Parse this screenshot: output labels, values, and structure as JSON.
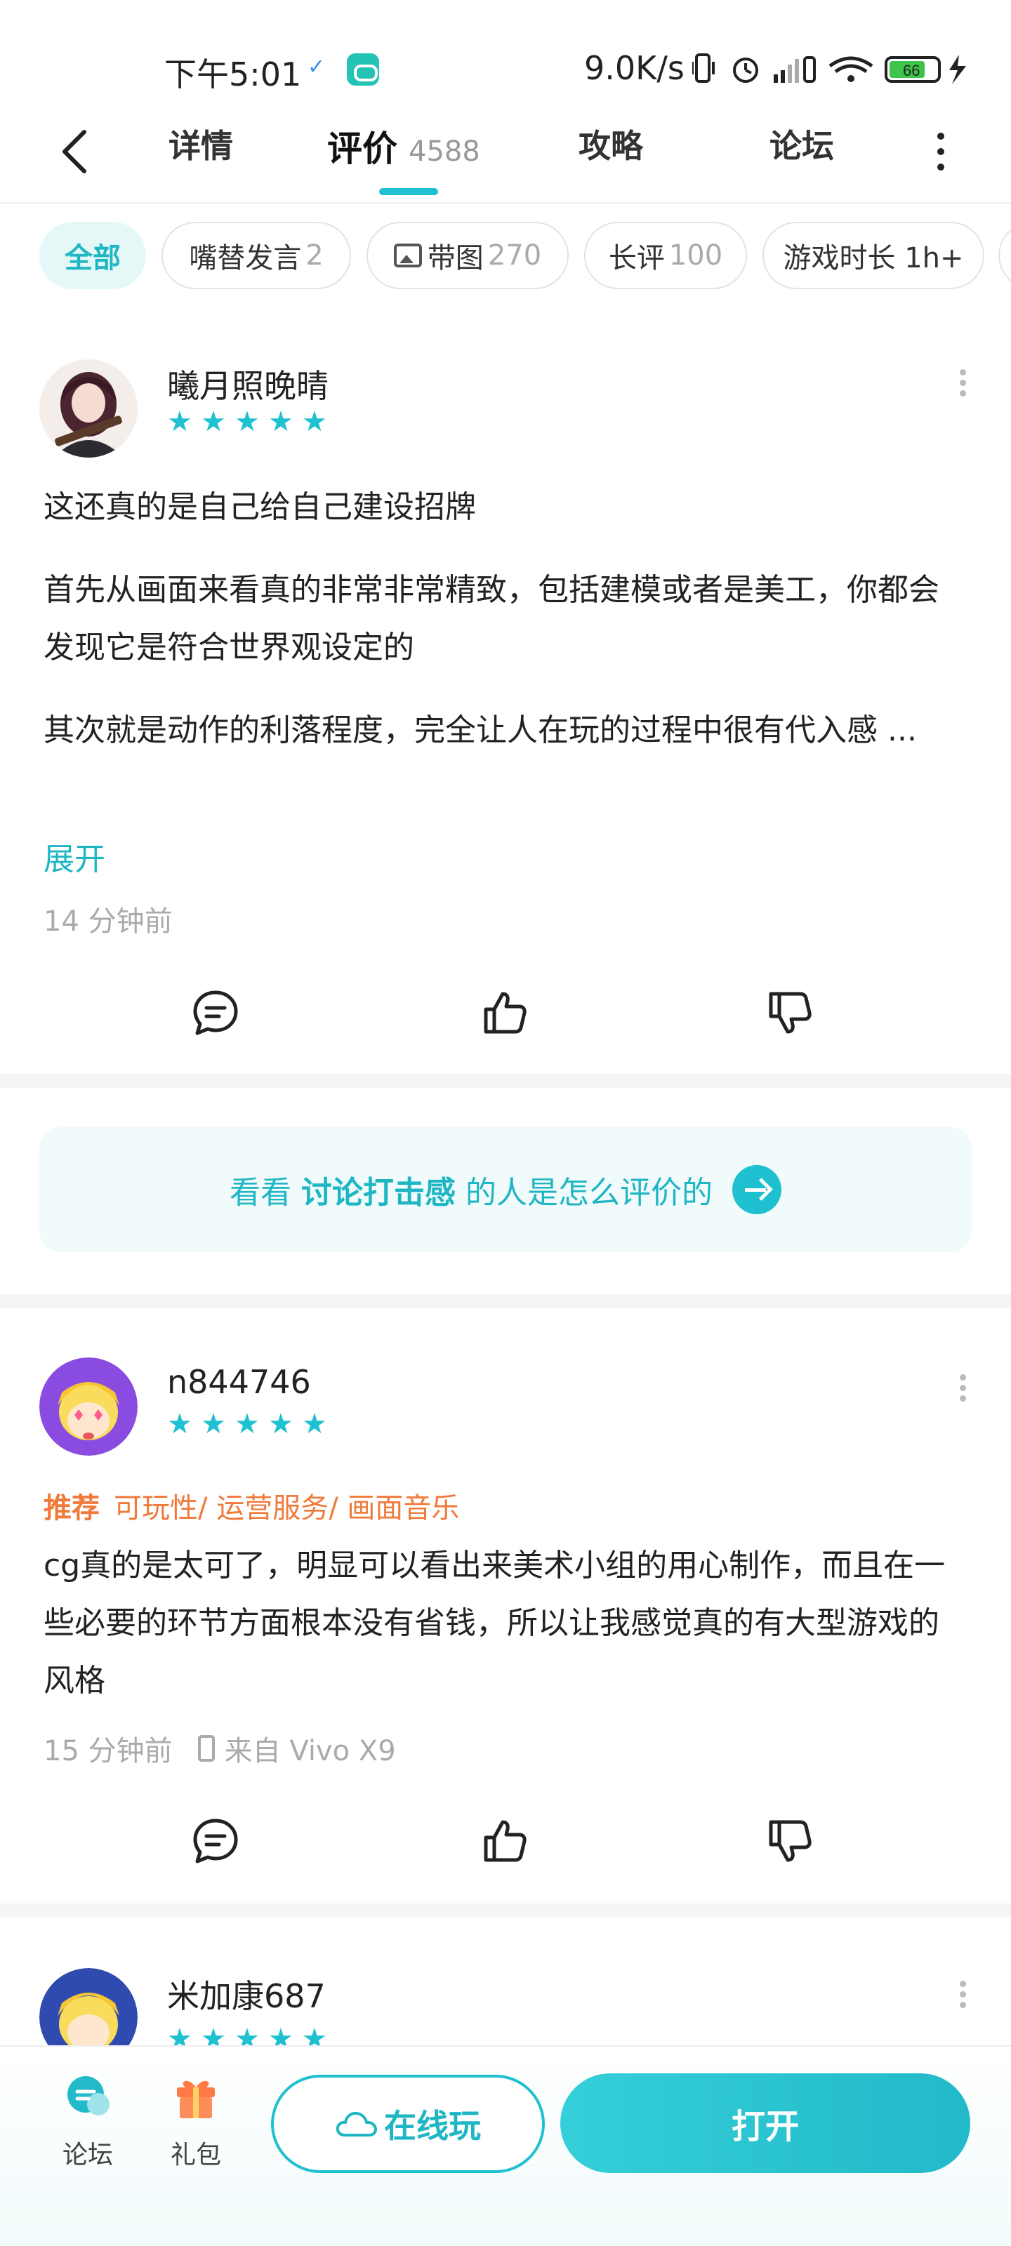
{
  "status_bar": {
    "time": "下午5:01",
    "network_speed": "9.0K/s",
    "battery": "66"
  },
  "nav": {
    "tabs": [
      {
        "label": "详情"
      },
      {
        "label": "评价",
        "count": "4588"
      },
      {
        "label": "攻略"
      },
      {
        "label": "论坛"
      }
    ]
  },
  "filters": [
    {
      "label": "全部",
      "count": ""
    },
    {
      "label": "嘴替发言",
      "count": "2"
    },
    {
      "label": "带图",
      "count": "270"
    },
    {
      "label": "长评",
      "count": "100"
    },
    {
      "label": "游戏时长 1h+",
      "count": ""
    }
  ],
  "reviews": [
    {
      "user": "曦月照晚晴",
      "rating": 5,
      "paragraphs": [
        "这还真的是自己给自己建设招牌",
        "首先从画面来看真的非常非常精致，包括建模或者是美工，你都会发现它是符合世界观设定的",
        "其次就是动作的利落程度，完全让人在玩的过程中很有代入感 ..."
      ],
      "expand_label": "展开",
      "time": "14 分钟前"
    },
    {
      "user": "n844746",
      "rating": 5,
      "tag_label": "推荐",
      "tags": "可玩性/ 运营服务/ 画面音乐",
      "paragraphs": [
        "cg真的是太可了，明显可以看出来美术小组的用心制作，而且在一些必要的环节方面根本没有省钱，所以让我感觉真的有大型游戏的风格"
      ],
      "time": "15 分钟前",
      "device": "来自 Vivo X9"
    },
    {
      "user": "米加康687",
      "rating": 5
    }
  ],
  "banner": {
    "prefix": "看看",
    "keyword": "讨论打击感",
    "suffix": "的人是怎么评价的"
  },
  "bottom_bar": {
    "forum_label": "论坛",
    "gift_label": "礼包",
    "online_label": "在线玩",
    "open_label": "打开"
  },
  "colors": {
    "accent": "#1fc0cf",
    "tag": "#f07a3a"
  }
}
